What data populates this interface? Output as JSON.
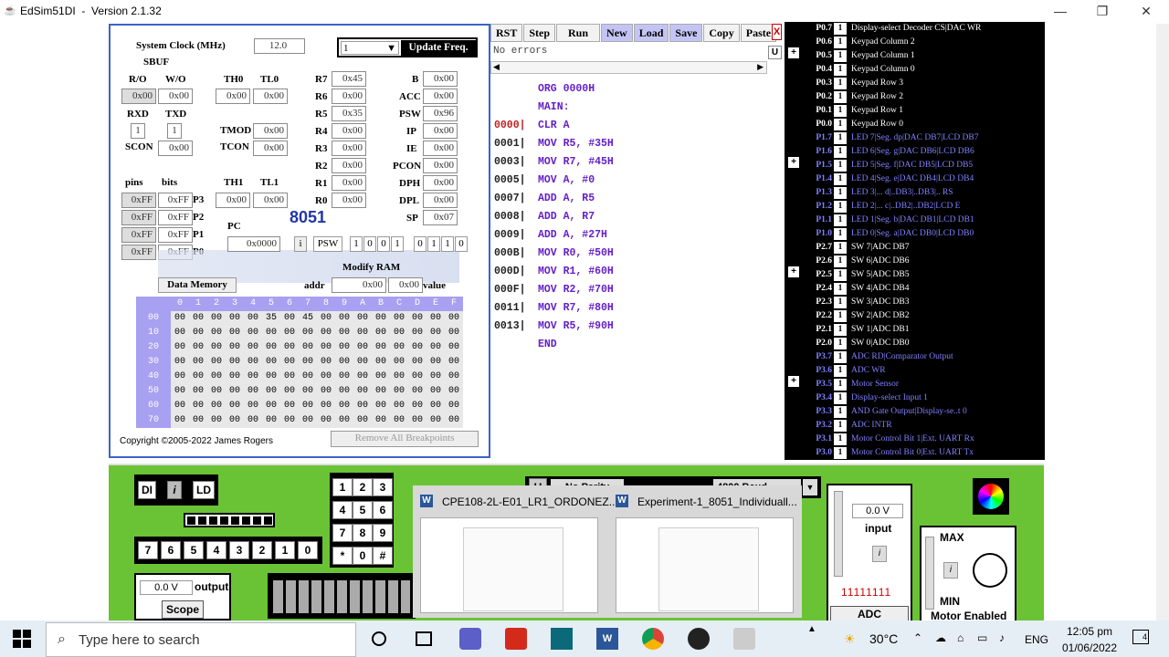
{
  "window": {
    "title": "EdSim51DI",
    "version": "Version 2.1.32"
  },
  "left": {
    "system_clock_label": "System Clock (MHz)",
    "system_clock_value": "12.0",
    "sbuf_label": "SBUF",
    "update_value": "1",
    "update_label": "Update Freq.",
    "ro_label": "R/O",
    "wo_label": "W/O",
    "ro_value": "0x00",
    "wo_value": "0x00",
    "th0_label": "TH0",
    "tl0_label": "TL0",
    "th0_value": "0x00",
    "tl0_value": "0x00",
    "rxd_label": "RXD",
    "txd_label": "TXD",
    "rxd_value": "1",
    "txd_value": "1",
    "tmod_label": "TMOD",
    "tmod_value": "0x00",
    "tcon_label": "TCON",
    "tcon_value": "0x00",
    "scon_label": "SCON",
    "scon_value": "0x00",
    "pins_label": "pins",
    "bits_label": "bits",
    "th1_label": "TH1",
    "tl1_label": "TL1",
    "th1_value": "0x00",
    "tl1_value": "0x00",
    "ports": [
      {
        "pins": "0xFF",
        "bits": "0xFF",
        "name": "P3"
      },
      {
        "pins": "0xFF",
        "bits": "0xFF",
        "name": "P2"
      },
      {
        "pins": "0xFF",
        "bits": "0xFF",
        "name": "P1"
      },
      {
        "pins": "0xFF",
        "bits": "0xFF",
        "name": "P0"
      }
    ],
    "regs_a": [
      {
        "name": "R7",
        "value": "0x45"
      },
      {
        "name": "R6",
        "value": "0x00"
      },
      {
        "name": "R5",
        "value": "0x35"
      },
      {
        "name": "R4",
        "value": "0x00"
      },
      {
        "name": "R3",
        "value": "0x00"
      },
      {
        "name": "R2",
        "value": "0x00"
      },
      {
        "name": "R1",
        "value": "0x00"
      },
      {
        "name": "R0",
        "value": "0x00"
      }
    ],
    "regs_b": [
      {
        "name": "B",
        "value": "0x00"
      },
      {
        "name": "ACC",
        "value": "0x00"
      },
      {
        "name": "PSW",
        "value": "0x96"
      },
      {
        "name": "IP",
        "value": "0x00"
      },
      {
        "name": "IE",
        "value": "0x00"
      },
      {
        "name": "PCON",
        "value": "0x00"
      },
      {
        "name": "DPH",
        "value": "0x00"
      },
      {
        "name": "DPL",
        "value": "0x00"
      },
      {
        "name": "SP",
        "value": "0x07"
      }
    ],
    "pc_label": "PC",
    "pc_value": "0x0000",
    "chip_label": "8051",
    "i_label": "i",
    "psw_label": "PSW",
    "psw_bits": [
      "1",
      "0",
      "0",
      "1",
      "0",
      "1",
      "1",
      "0"
    ],
    "modify_ram_label": "Modify RAM",
    "data_memory_label": "Data Memory",
    "addr_label": "addr",
    "addr_value": "0x00",
    "ram_value": "0x00",
    "value_label": "value",
    "mem_cols": [
      "0",
      "1",
      "2",
      "3",
      "4",
      "5",
      "6",
      "7",
      "8",
      "9",
      "A",
      "B",
      "C",
      "D",
      "E",
      "F"
    ],
    "mem_rows": [
      {
        "addr": "00",
        "cells": [
          "00",
          "00",
          "00",
          "00",
          "00",
          "35",
          "00",
          "45",
          "00",
          "00",
          "00",
          "00",
          "00",
          "00",
          "00",
          "00"
        ]
      },
      {
        "addr": "10",
        "cells": [
          "00",
          "00",
          "00",
          "00",
          "00",
          "00",
          "00",
          "00",
          "00",
          "00",
          "00",
          "00",
          "00",
          "00",
          "00",
          "00"
        ]
      },
      {
        "addr": "20",
        "cells": [
          "00",
          "00",
          "00",
          "00",
          "00",
          "00",
          "00",
          "00",
          "00",
          "00",
          "00",
          "00",
          "00",
          "00",
          "00",
          "00"
        ]
      },
      {
        "addr": "30",
        "cells": [
          "00",
          "00",
          "00",
          "00",
          "00",
          "00",
          "00",
          "00",
          "00",
          "00",
          "00",
          "00",
          "00",
          "00",
          "00",
          "00"
        ]
      },
      {
        "addr": "40",
        "cells": [
          "00",
          "00",
          "00",
          "00",
          "00",
          "00",
          "00",
          "00",
          "00",
          "00",
          "00",
          "00",
          "00",
          "00",
          "00",
          "00"
        ]
      },
      {
        "addr": "50",
        "cells": [
          "00",
          "00",
          "00",
          "00",
          "00",
          "00",
          "00",
          "00",
          "00",
          "00",
          "00",
          "00",
          "00",
          "00",
          "00",
          "00"
        ]
      },
      {
        "addr": "60",
        "cells": [
          "00",
          "00",
          "00",
          "00",
          "00",
          "00",
          "00",
          "00",
          "00",
          "00",
          "00",
          "00",
          "00",
          "00",
          "00",
          "00"
        ]
      },
      {
        "addr": "70",
        "cells": [
          "00",
          "00",
          "00",
          "00",
          "00",
          "00",
          "00",
          "00",
          "00",
          "00",
          "00",
          "00",
          "00",
          "00",
          "00",
          "00"
        ]
      }
    ],
    "copyright": "Copyright ©2005-2022 James Rogers",
    "remove_bp": "Remove All Breakpoints"
  },
  "toolbar": [
    "RST",
    "Step",
    "Run",
    "New",
    "Load",
    "Save",
    "Copy",
    "Paste"
  ],
  "toolbar_close": "X",
  "status": "No errors",
  "u_label": "U",
  "code": [
    {
      "addr": "",
      "text": "ORG 0000H"
    },
    {
      "addr": "",
      "text": "MAIN:"
    },
    {
      "addr": "0000|",
      "text": "CLR A",
      "bp": true
    },
    {
      "addr": "0001|",
      "text": "MOV R5, #35H"
    },
    {
      "addr": "0003|",
      "text": "MOV R7, #45H"
    },
    {
      "addr": "0005|",
      "text": "MOV A, #0"
    },
    {
      "addr": "0007|",
      "text": "ADD A, R5"
    },
    {
      "addr": "0008|",
      "text": "ADD A, R7"
    },
    {
      "addr": "0009|",
      "text": "ADD A, #27H"
    },
    {
      "addr": "000B|",
      "text": "MOV R0, #50H"
    },
    {
      "addr": "000D|",
      "text": "MOV R1, #60H"
    },
    {
      "addr": "000F|",
      "text": "MOV R2, #70H"
    },
    {
      "addr": "0011|",
      "text": "MOV R7, #80H"
    },
    {
      "addr": "0013|",
      "text": "MOV R5, #90H"
    },
    {
      "addr": "",
      "text": "END"
    }
  ],
  "pins": [
    {
      "pin": "P0.7",
      "v": "1",
      "d": "Display-select Decoder CS|DAC WR",
      "blue": false
    },
    {
      "pin": "P0.6",
      "v": "1",
      "d": "Keypad Column 2",
      "blue": false
    },
    {
      "pin": "P0.5",
      "v": "1",
      "d": "Keypad Column 1",
      "blue": false
    },
    {
      "pin": "P0.4",
      "v": "1",
      "d": "Keypad Column 0",
      "blue": false
    },
    {
      "pin": "P0.3",
      "v": "1",
      "d": "Keypad Row 3",
      "blue": false
    },
    {
      "pin": "P0.2",
      "v": "1",
      "d": "Keypad Row 2",
      "blue": false
    },
    {
      "pin": "P0.1",
      "v": "1",
      "d": "Keypad Row 1",
      "blue": false
    },
    {
      "pin": "P0.0",
      "v": "1",
      "d": "Keypad Row 0",
      "blue": false
    },
    {
      "pin": "P1.7",
      "v": "1",
      "d": "LED 7|Seg. dp|DAC DB7|LCD DB7",
      "blue": true
    },
    {
      "pin": "P1.6",
      "v": "1",
      "d": "LED 6|Seg. g|DAC DB6|LCD DB6",
      "blue": true
    },
    {
      "pin": "P1.5",
      "v": "1",
      "d": "LED 5|Seg. f|DAC DB5|LCD DB5",
      "blue": true
    },
    {
      "pin": "P1.4",
      "v": "1",
      "d": "LED 4|Seg. e|DAC DB4|LCD DB4",
      "blue": true
    },
    {
      "pin": "P1.3",
      "v": "1",
      "d": "LED 3|... d|..DB3|..DB3|.. RS",
      "blue": true
    },
    {
      "pin": "P1.2",
      "v": "1",
      "d": "LED 2|... c|..DB2|..DB2|LCD E",
      "blue": true
    },
    {
      "pin": "P1.1",
      "v": "1",
      "d": "LED 1|Seg. b|DAC DB1|LCD DB1",
      "blue": true
    },
    {
      "pin": "P1.0",
      "v": "1",
      "d": "LED 0|Seg. a|DAC DB0|LCD DB0",
      "blue": true
    },
    {
      "pin": "P2.7",
      "v": "1",
      "d": "SW 7|ADC DB7",
      "blue": false
    },
    {
      "pin": "P2.6",
      "v": "1",
      "d": "SW 6|ADC DB6",
      "blue": false
    },
    {
      "pin": "P2.5",
      "v": "1",
      "d": "SW 5|ADC DB5",
      "blue": false
    },
    {
      "pin": "P2.4",
      "v": "1",
      "d": "SW 4|ADC DB4",
      "blue": false
    },
    {
      "pin": "P2.3",
      "v": "1",
      "d": "SW 3|ADC DB3",
      "blue": false
    },
    {
      "pin": "P2.2",
      "v": "1",
      "d": "SW 2|ADC DB2",
      "blue": false
    },
    {
      "pin": "P2.1",
      "v": "1",
      "d": "SW 1|ADC DB1",
      "blue": false
    },
    {
      "pin": "P2.0",
      "v": "1",
      "d": "SW 0|ADC DB0",
      "blue": false
    },
    {
      "pin": "P3.7",
      "v": "1",
      "d": "ADC RD|Comparator Output",
      "blue": true
    },
    {
      "pin": "P3.6",
      "v": "1",
      "d": "ADC WR",
      "blue": true
    },
    {
      "pin": "P3.5",
      "v": "1",
      "d": "Motor Sensor",
      "blue": true
    },
    {
      "pin": "P3.4",
      "v": "1",
      "d": "Display-select Input 1",
      "blue": true
    },
    {
      "pin": "P3.3",
      "v": "1",
      "d": "AND Gate Output|Display-se..t 0",
      "blue": true
    },
    {
      "pin": "P3.2",
      "v": "1",
      "d": "ADC INTR",
      "blue": true
    },
    {
      "pin": "P3.1",
      "v": "1",
      "d": "Motor Control Bit 1|Ext. UART Rx",
      "blue": true
    },
    {
      "pin": "P3.0",
      "v": "1",
      "d": "Motor Control Bit 0|Ext. UART Tx",
      "blue": true
    }
  ],
  "periph": {
    "di": "DI",
    "i": "i",
    "ld": "LD",
    "switches": [
      "7",
      "6",
      "5",
      "4",
      "3",
      "2",
      "1",
      "0"
    ],
    "output_value": "0.0 V",
    "output_label": "output",
    "scope": "Scope",
    "keypad": [
      "1",
      "2",
      "3",
      "4",
      "5",
      "6",
      "7",
      "8",
      "9",
      "*",
      "0",
      "#"
    ],
    "uart_u": "U",
    "no_parity": "No Parity",
    "baud": "4800 Baud",
    "input_value": "0.0 V",
    "input_label": "input",
    "adc_bits": "11111111",
    "adc": "ADC",
    "max": "MAX",
    "min": "MIN",
    "motor": "Motor Enabled"
  },
  "popup": {
    "left": "CPE108-2L-E01_LR1_ORDONEZ...",
    "right": "Experiment-1_8051_Individuall..."
  },
  "taskbar": {
    "search": "Type here to search",
    "temp": "30°C",
    "lang": "ENG",
    "time": "12:05 pm",
    "date": "01/06/2022",
    "notif": "4"
  }
}
